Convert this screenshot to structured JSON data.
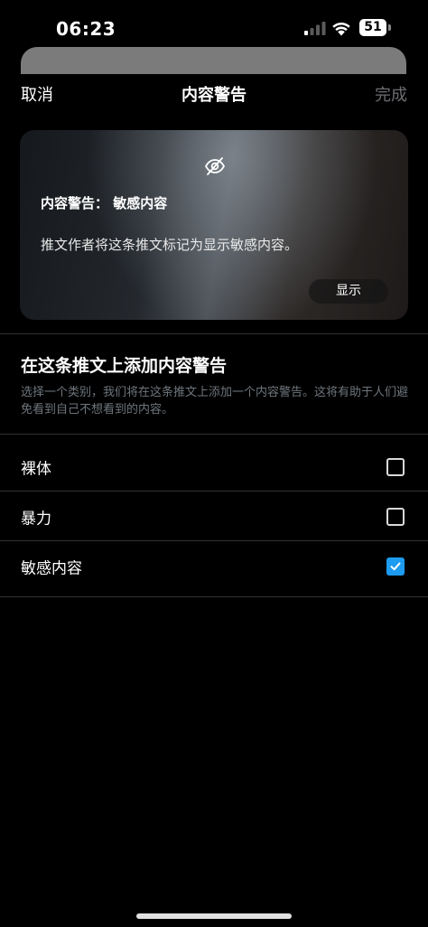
{
  "status_bar": {
    "time": "06:23",
    "battery": "51"
  },
  "nav": {
    "cancel": "取消",
    "title": "内容警告",
    "done": "完成"
  },
  "preview": {
    "heading": "内容警告： 敏感内容",
    "description": "推文作者将这条推文标记为显示敏感内容。",
    "show_button": "显示"
  },
  "section": {
    "title": "在这条推文上添加内容警告",
    "description": "选择一个类别，我们将在这条推文上添加一个内容警告。这将有助于人们避免看到自己不想看到的内容。"
  },
  "options": [
    {
      "label": "裸体",
      "checked": false
    },
    {
      "label": "暴力",
      "checked": false
    },
    {
      "label": "敏感内容",
      "checked": true
    }
  ],
  "colors": {
    "background": "#000000",
    "accent": "#1d9bf0",
    "muted_text": "#6e767d",
    "divider": "#2f3336"
  }
}
